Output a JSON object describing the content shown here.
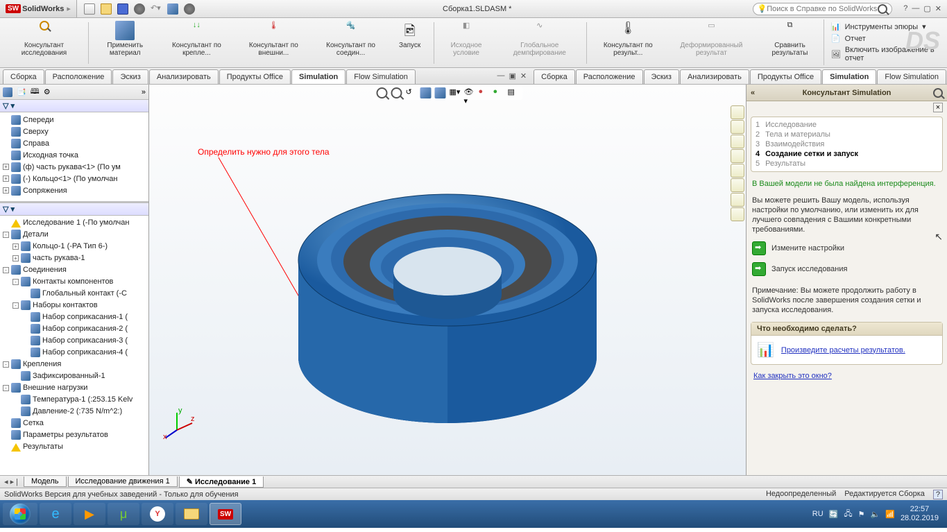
{
  "app": {
    "name": "SolidWorks",
    "doc_title": "Сборка1.SLDASM *",
    "search_placeholder": "Поиск в Справке по SolidWorks"
  },
  "ribbon": {
    "buttons": [
      {
        "label": "Консультант исследования"
      },
      {
        "label": "Применить материал"
      },
      {
        "label": "Консультант по крепле..."
      },
      {
        "label": "Консультант по внешни..."
      },
      {
        "label": "Консультант по соедин..."
      },
      {
        "label": "Запуск"
      },
      {
        "label": "Исходное условие"
      },
      {
        "label": "Глобальное демпфирование"
      },
      {
        "label": "Консультант по результ..."
      },
      {
        "label": "Деформированный результат"
      },
      {
        "label": "Сравнить результаты"
      }
    ],
    "right": {
      "tools": "Инструменты эпюры",
      "report": "Отчет",
      "include": "Включить изображение в отчет"
    }
  },
  "tabs": [
    "Сборка",
    "Расположение",
    "Эскиз",
    "Анализировать",
    "Продукты Office",
    "Simulation",
    "Flow Simulation"
  ],
  "active_tab": 5,
  "tree_upper": [
    {
      "t": "Спереди",
      "cls": ""
    },
    {
      "t": "Сверху",
      "cls": ""
    },
    {
      "t": "Справа",
      "cls": ""
    },
    {
      "t": "Исходная точка",
      "cls": ""
    },
    {
      "t": "(ф) часть рукава<1> (По ум",
      "cls": "",
      "pm": "+"
    },
    {
      "t": "(-) Кольцо<1> (По умолчан",
      "cls": "",
      "pm": "+"
    },
    {
      "t": "Сопряжения",
      "cls": "",
      "pm": "+"
    }
  ],
  "tree_lower": [
    {
      "t": "Исследование 1 (-По умолчан",
      "i": 0,
      "ico": "warn"
    },
    {
      "t": "Детали",
      "i": 0,
      "pm": "-"
    },
    {
      "t": "Кольцо-1 (-PA Тип 6-)",
      "i": 1,
      "pm": "+"
    },
    {
      "t": "часть рукава-1",
      "i": 1,
      "pm": "+"
    },
    {
      "t": "Соединения",
      "i": 0,
      "pm": "-"
    },
    {
      "t": "Контакты компонентов",
      "i": 1,
      "pm": "-"
    },
    {
      "t": "Глобальный контакт (-С",
      "i": 2
    },
    {
      "t": "Наборы контактов",
      "i": 1,
      "pm": "-"
    },
    {
      "t": "Набор соприкасания-1 (",
      "i": 2
    },
    {
      "t": "Набор соприкасания-2 (",
      "i": 2
    },
    {
      "t": "Набор соприкасания-3 (",
      "i": 2
    },
    {
      "t": "Набор соприкасания-4 (",
      "i": 2
    },
    {
      "t": "Крепления",
      "i": 0,
      "pm": "-"
    },
    {
      "t": "Зафиксированный-1",
      "i": 1
    },
    {
      "t": "Внешние нагрузки",
      "i": 0,
      "pm": "-"
    },
    {
      "t": "Температура-1 (:253.15 Kelv",
      "i": 1
    },
    {
      "t": "Давление-2 (:735 N/m^2:)",
      "i": 1
    },
    {
      "t": "Сетка",
      "i": 0
    },
    {
      "t": "Параметры результатов",
      "i": 0
    },
    {
      "t": "Результаты",
      "i": 0,
      "ico": "warn"
    }
  ],
  "viewport": {
    "annotation": "Определить нужно для этого тела"
  },
  "consultant": {
    "title": "Консультант Simulation",
    "steps": [
      {
        "n": "1",
        "t": "Исследование"
      },
      {
        "n": "2",
        "t": "Тела и материалы"
      },
      {
        "n": "3",
        "t": "Взаимодействия"
      },
      {
        "n": "4",
        "t": "Создание сетки и запуск",
        "on": true
      },
      {
        "n": "5",
        "t": "Результаты"
      }
    ],
    "ok_text": "В Вашей модели не была найдена интерференция.",
    "body_text": "Вы можете решить Вашу модель, используя настройки по умолчанию, или изменить их для лучшего совпадения с Вашими конкретными требованиями.",
    "act1": "Измените настройки",
    "act2": "Запуск исследования",
    "note": "Примечание: Вы можете продолжить работу в SolidWorks после завершения создания сетки и запуска исследования.",
    "box_title": "Что необходимо сделать?",
    "box_link": "Произведите расчеты результатов.",
    "close_link": "Как закрыть это окно?"
  },
  "bottom_tabs": [
    "Модель",
    "Исследование движения 1",
    "Исследование 1"
  ],
  "bottom_active": 2,
  "status": {
    "left": "SolidWorks Версия для учебных заведений - Только для обучения",
    "r1": "Недоопределенный",
    "r2": "Редактируется Сборка"
  },
  "tray": {
    "lang": "RU",
    "time": "22:57",
    "date": "28.02.2019"
  }
}
